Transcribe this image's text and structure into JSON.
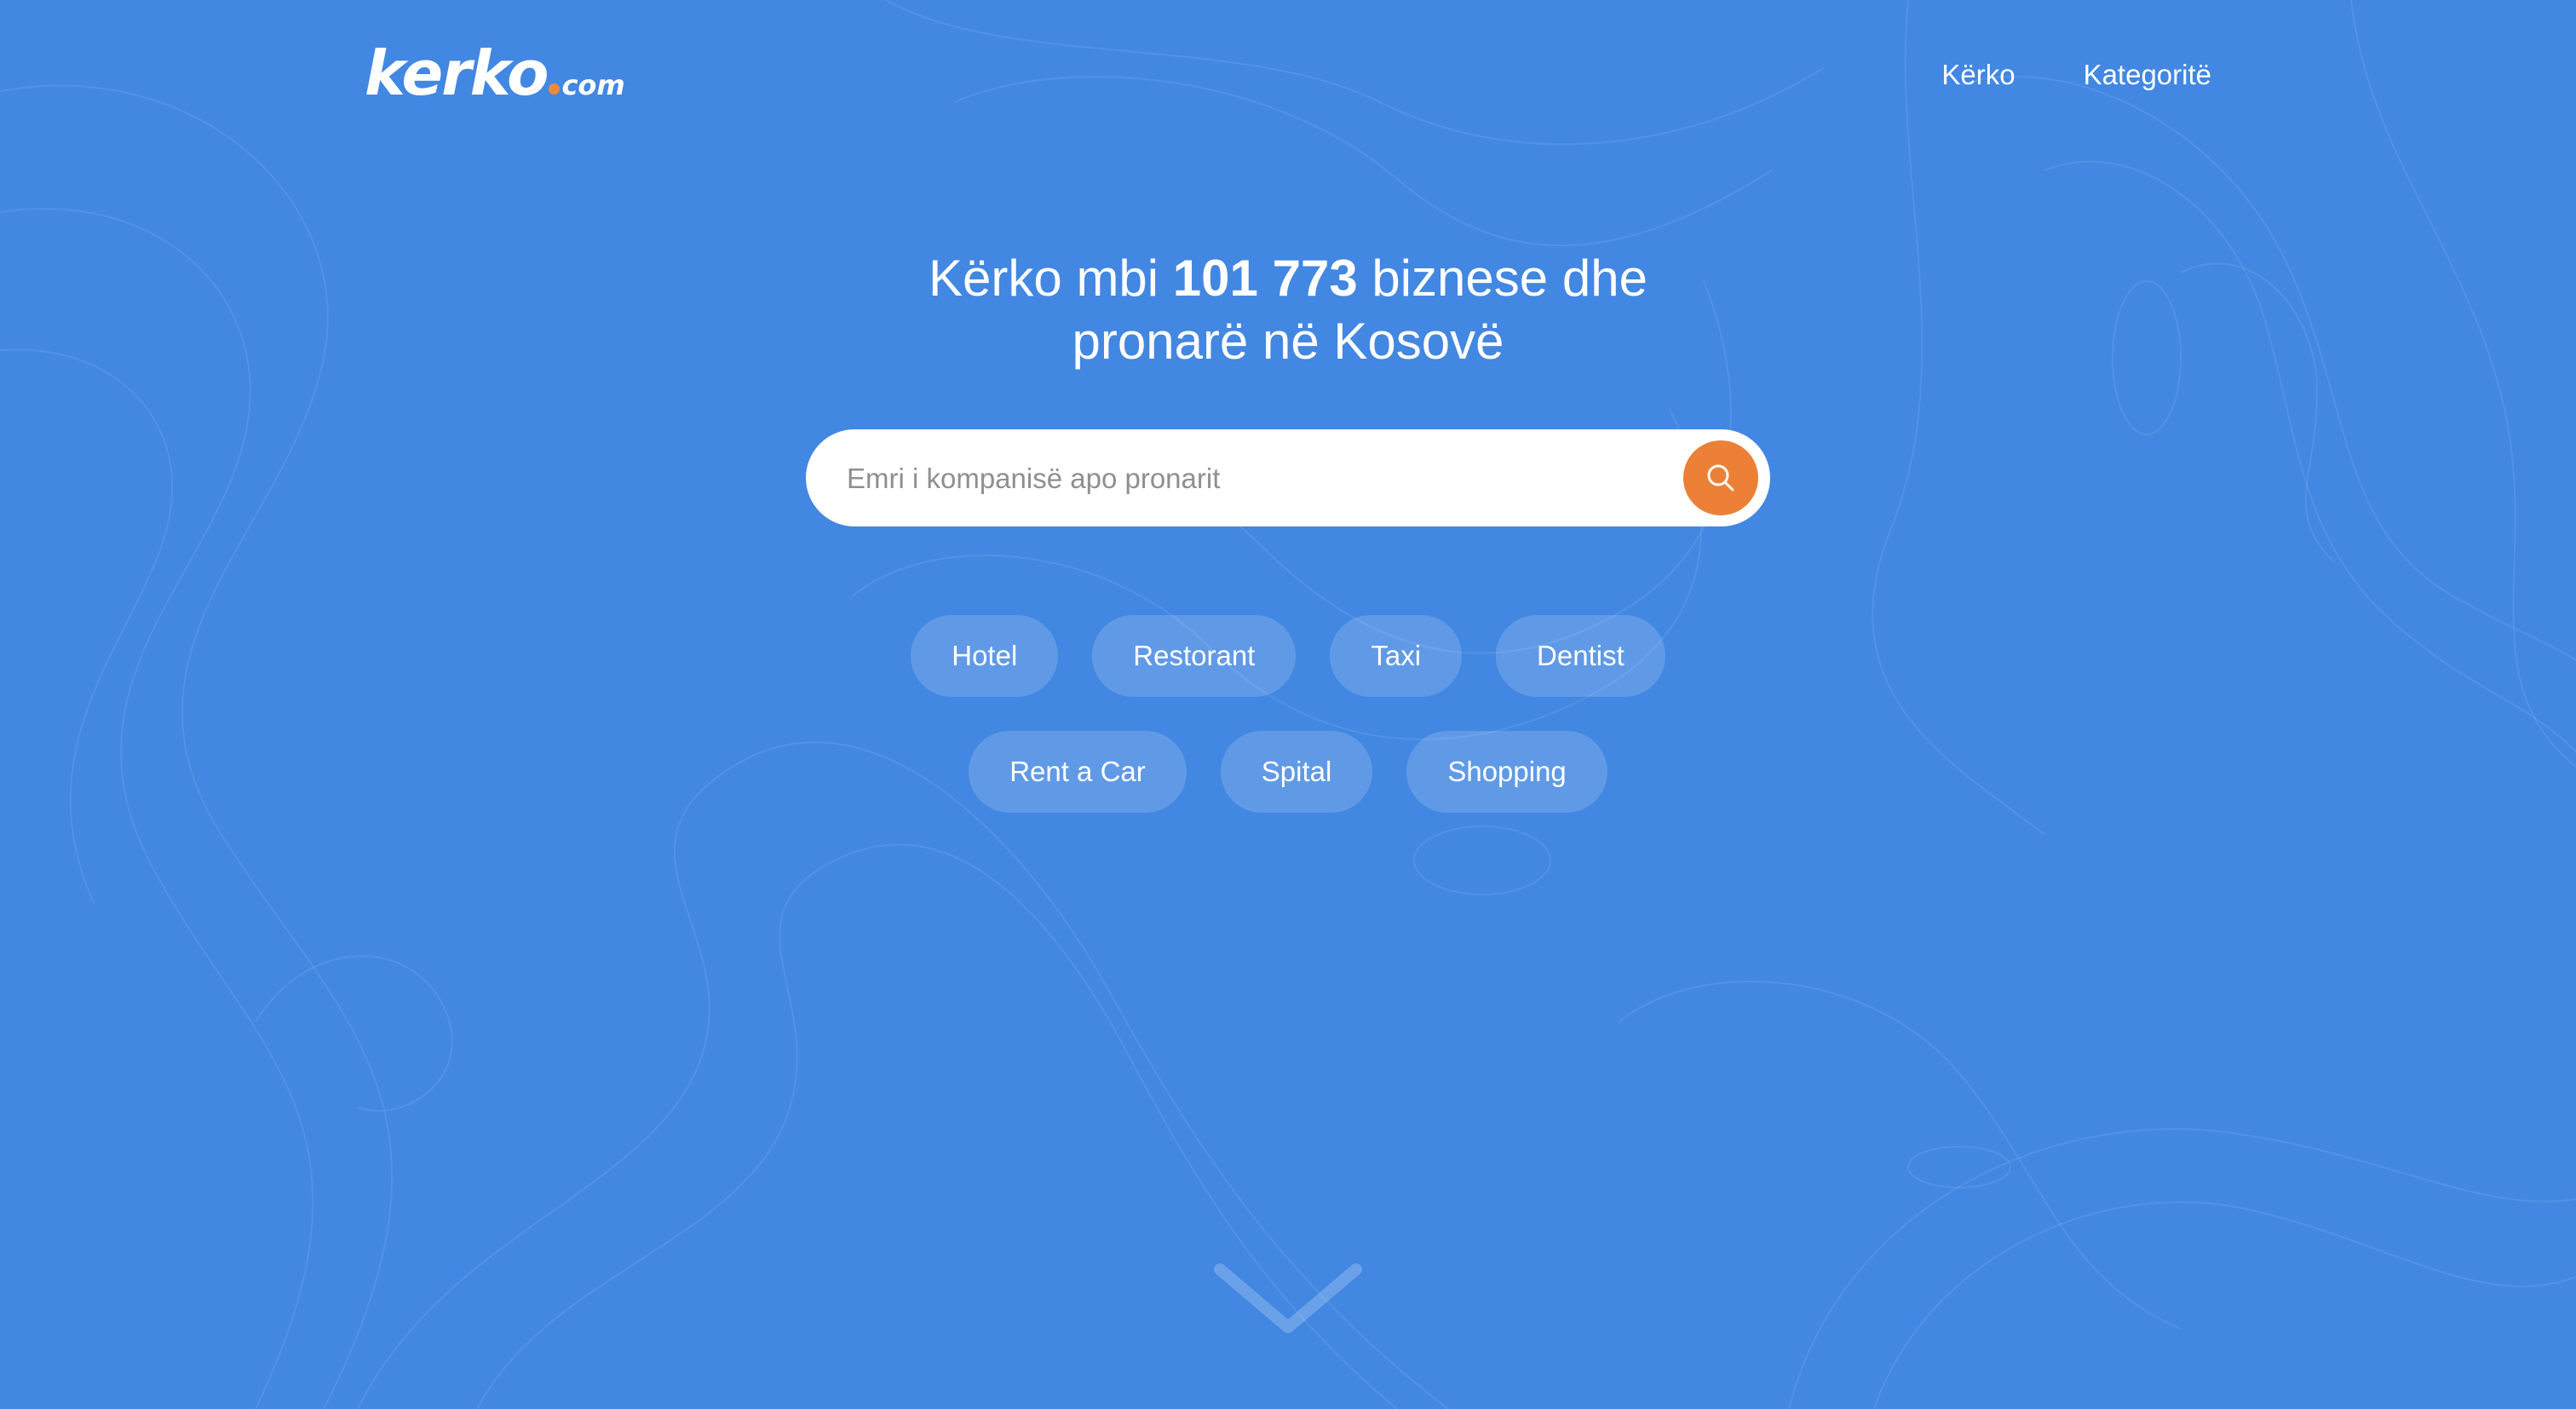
{
  "header": {
    "logo": {
      "main": "kerko",
      "tld": "com",
      "dot_color": "#f08a3c"
    },
    "nav": [
      {
        "label": "Kërko"
      },
      {
        "label": "Kategoritë"
      }
    ]
  },
  "hero": {
    "title_before": "Kërko mbi ",
    "title_count": "101 773",
    "title_after_line1": " biznese dhe",
    "title_line2": "pronarë në Kosovë"
  },
  "search": {
    "placeholder": "Emri i kompanisë apo pronarit",
    "value": "",
    "button_icon": "search-icon",
    "button_color": "#eb8036"
  },
  "categories": {
    "row1": [
      {
        "label": "Hotel"
      },
      {
        "label": "Restorant"
      },
      {
        "label": "Taxi"
      },
      {
        "label": "Dentist"
      }
    ],
    "row2": [
      {
        "label": "Rent a Car"
      },
      {
        "label": "Spital"
      },
      {
        "label": "Shopping"
      }
    ]
  },
  "scroll_indicator": {
    "icon": "chevron-down-icon"
  },
  "colors": {
    "background": "#4287e2",
    "accent": "#eb8036"
  }
}
